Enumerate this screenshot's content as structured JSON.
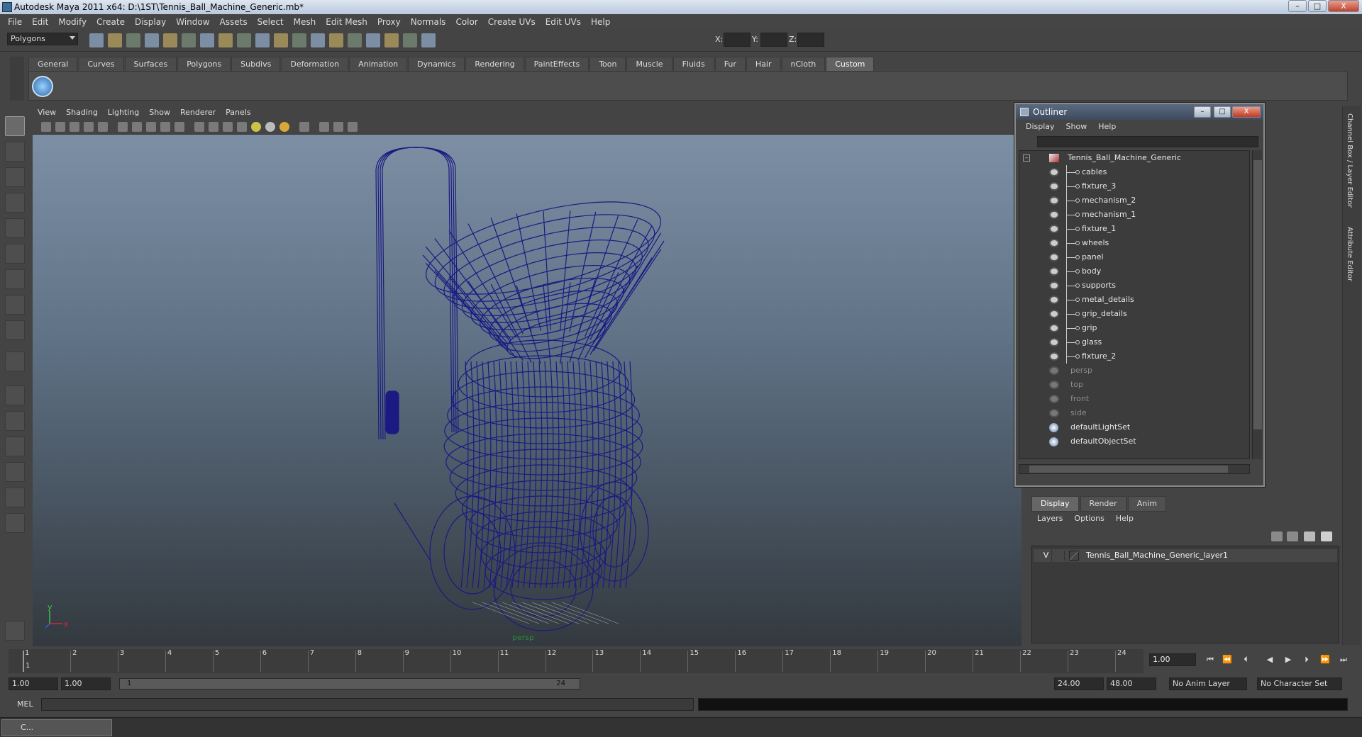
{
  "window": {
    "title": "Autodesk Maya 2011 x64: D:\\1ST\\Tennis_Ball_Machine_Generic.mb*",
    "min": "–",
    "max": "□",
    "close": "X"
  },
  "menubar": [
    "File",
    "Edit",
    "Modify",
    "Create",
    "Display",
    "Window",
    "Assets",
    "Select",
    "Mesh",
    "Edit Mesh",
    "Proxy",
    "Normals",
    "Color",
    "Create UVs",
    "Edit UVs",
    "Help"
  ],
  "statusline": {
    "mode": "Polygons",
    "x_label": "X:",
    "y_label": "Y:",
    "z_label": "Z:"
  },
  "shelf_tabs": [
    {
      "label": "General",
      "active": false
    },
    {
      "label": "Curves",
      "active": false
    },
    {
      "label": "Surfaces",
      "active": false
    },
    {
      "label": "Polygons",
      "active": false
    },
    {
      "label": "Subdivs",
      "active": false
    },
    {
      "label": "Deformation",
      "active": false
    },
    {
      "label": "Animation",
      "active": false
    },
    {
      "label": "Dynamics",
      "active": false
    },
    {
      "label": "Rendering",
      "active": false
    },
    {
      "label": "PaintEffects",
      "active": false
    },
    {
      "label": "Toon",
      "active": false
    },
    {
      "label": "Muscle",
      "active": false
    },
    {
      "label": "Fluids",
      "active": false
    },
    {
      "label": "Fur",
      "active": false
    },
    {
      "label": "Hair",
      "active": false
    },
    {
      "label": "nCloth",
      "active": false
    },
    {
      "label": "Custom",
      "active": true
    }
  ],
  "viewport": {
    "menu": [
      "View",
      "Shading",
      "Lighting",
      "Show",
      "Renderer",
      "Panels"
    ],
    "camera": "persp",
    "axis_y": "y",
    "axis_x": "x",
    "wire_color": "#1a1a82"
  },
  "outliner": {
    "title": "Outliner",
    "menu": [
      "Display",
      "Show",
      "Help"
    ],
    "root": "Tennis_Ball_Machine_Generic",
    "children": [
      "cables",
      "fixture_3",
      "mechanism_2",
      "mechanism_1",
      "fixture_1",
      "wheels",
      "panel",
      "body",
      "supports",
      "metal_details",
      "grip_details",
      "grip",
      "glass",
      "fixture_2"
    ],
    "cameras": [
      "persp",
      "top",
      "front",
      "side"
    ],
    "sets": [
      "defaultLightSet",
      "defaultObjectSet"
    ]
  },
  "layers": {
    "tabs": [
      {
        "label": "Display",
        "active": true
      },
      {
        "label": "Render",
        "active": false
      },
      {
        "label": "Anim",
        "active": false
      }
    ],
    "menu": [
      "Layers",
      "Options",
      "Help"
    ],
    "items": [
      {
        "visible": "V",
        "name": "Tennis_Ball_Machine_Generic_layer1"
      }
    ]
  },
  "side_labels": [
    "Channel Box / Layer Editor",
    "Attribute Editor"
  ],
  "timeline": {
    "frames": [
      "1",
      "2",
      "3",
      "4",
      "5",
      "6",
      "7",
      "8",
      "9",
      "10",
      "11",
      "12",
      "13",
      "14",
      "15",
      "16",
      "17",
      "18",
      "19",
      "20",
      "21",
      "22",
      "23",
      "24"
    ],
    "current_frame": "1",
    "time_field": "1.00"
  },
  "range": {
    "start": "1.00",
    "playback_start": "1.00",
    "slider_start": "1",
    "slider_end": "24",
    "playback_end": "24.00",
    "end": "48.00",
    "anim_layer": "No Anim Layer",
    "char_set": "No Character Set"
  },
  "cmdline": {
    "label": "MEL"
  },
  "taskbar": {
    "label": "C..."
  }
}
